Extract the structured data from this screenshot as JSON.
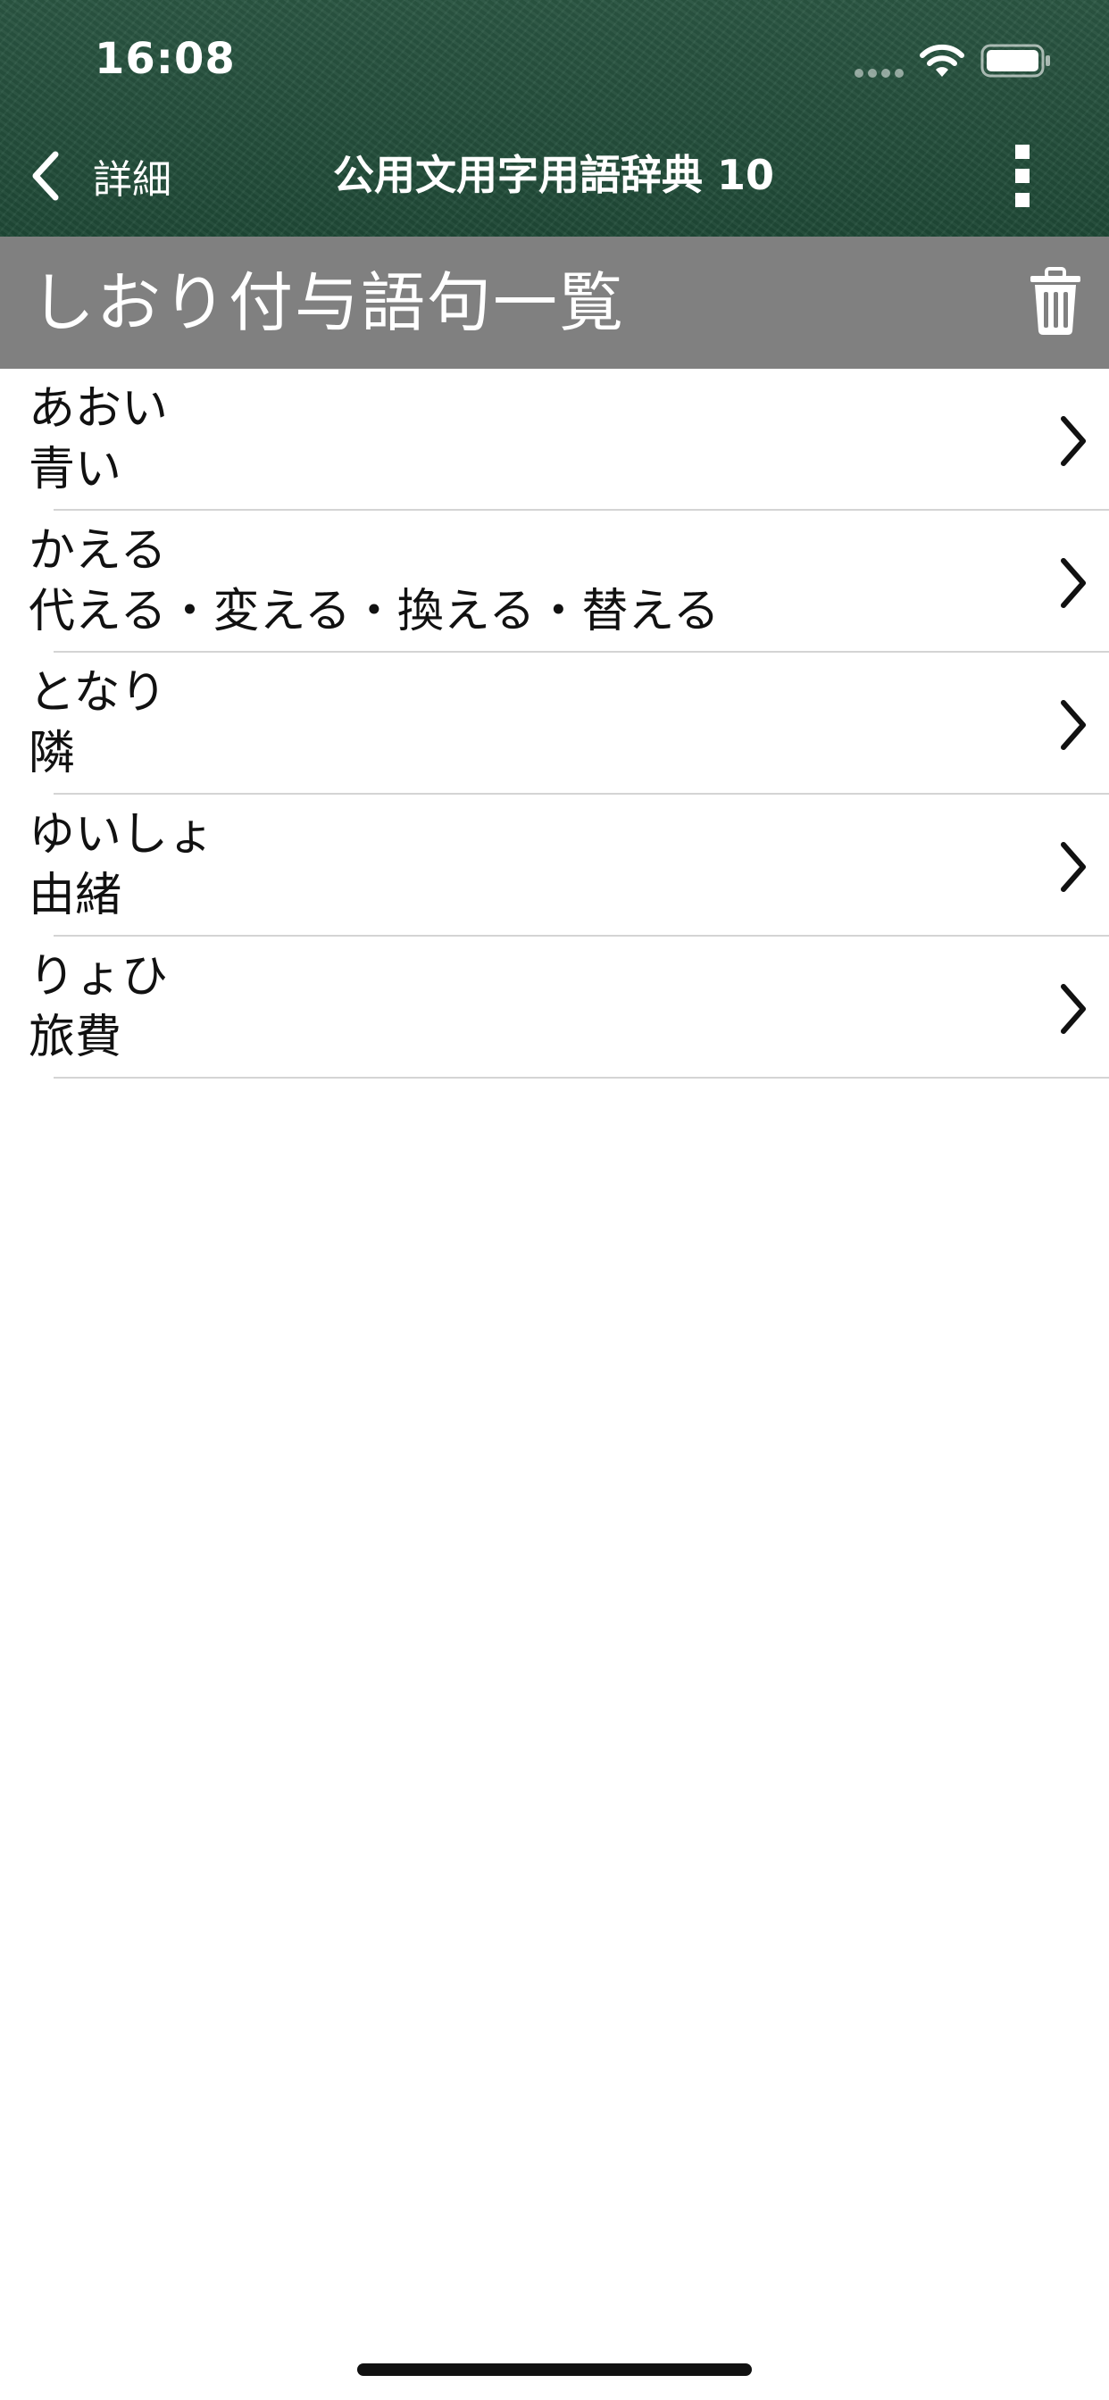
{
  "status_bar": {
    "time": "16:08"
  },
  "nav": {
    "back_label": "詳細",
    "title": "公用文用字用語辞典 10"
  },
  "section": {
    "title": "しおり付与語句一覧"
  },
  "bookmarks": [
    {
      "reading": "あおい",
      "word": "青い"
    },
    {
      "reading": "かえる",
      "word": "代える・変える・換える・替える"
    },
    {
      "reading": "となり",
      "word": "隣"
    },
    {
      "reading": "ゆいしょ",
      "word": "由緒"
    },
    {
      "reading": "りょひ",
      "word": "旅費"
    }
  ],
  "colors": {
    "header_green": "#24503d",
    "section_gray": "#808080"
  },
  "icons": {
    "wifi": "wifi-icon",
    "battery": "battery-icon",
    "back": "chevron-left-icon",
    "more": "more-vertical-icon",
    "trash": "trash-icon",
    "disclosure": "chevron-right-icon"
  }
}
